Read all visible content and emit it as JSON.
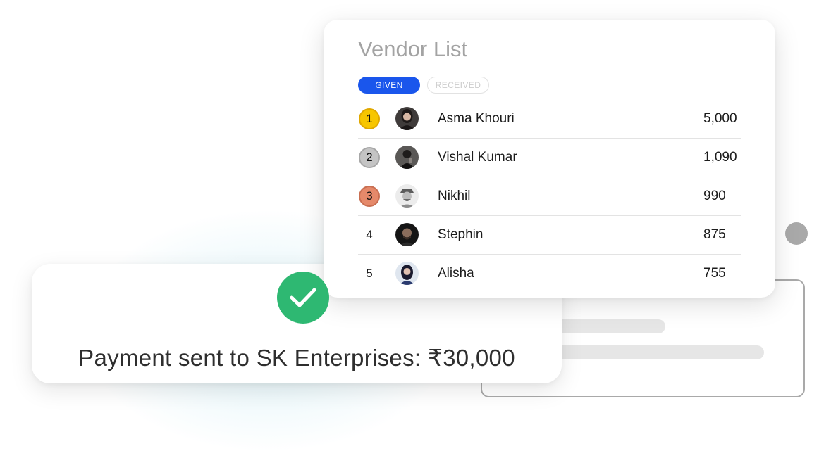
{
  "vendor_list": {
    "title": "Vendor List",
    "tabs": [
      {
        "label": "GIVEN",
        "active": true
      },
      {
        "label": "RECEIVED",
        "active": false
      }
    ],
    "vendors": [
      {
        "rank": "1",
        "name": "Asma Khouri",
        "amount": "5,000",
        "badge_color": "#f7c600"
      },
      {
        "rank": "2",
        "name": "Vishal Kumar",
        "amount": "1,090",
        "badge_color": "#c4c4c4"
      },
      {
        "rank": "3",
        "name": "Nikhil",
        "amount": "990",
        "badge_color": "#e5896a"
      },
      {
        "rank": "4",
        "name": "Stephin",
        "amount": "875",
        "badge_color": ""
      },
      {
        "rank": "5",
        "name": "Alisha",
        "amount": "755",
        "badge_color": ""
      }
    ]
  },
  "payment": {
    "message": "Payment sent to SK Enterprises: ₹30,000",
    "status_icon": "check-icon",
    "status_color": "#2eb872"
  },
  "colors": {
    "accent": "#1a56ec",
    "gold": "#f7c600",
    "silver": "#c4c4c4",
    "bronze": "#e5896a"
  }
}
